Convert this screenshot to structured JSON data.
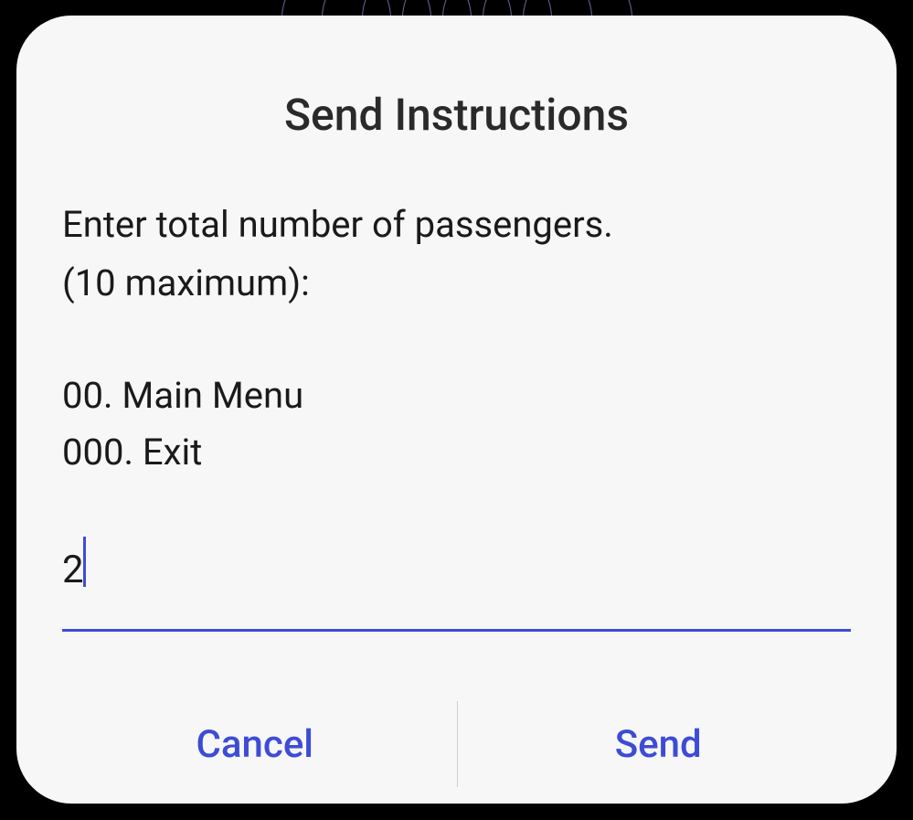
{
  "dialog": {
    "title": "Send Instructions",
    "instruction_line1": "Enter total number of passengers.",
    "instruction_line2": "(10 maximum):",
    "menu_option1": "00. Main Menu",
    "menu_option2": "000. Exit",
    "input_value": "2",
    "cancel_label": "Cancel",
    "send_label": "Send"
  }
}
